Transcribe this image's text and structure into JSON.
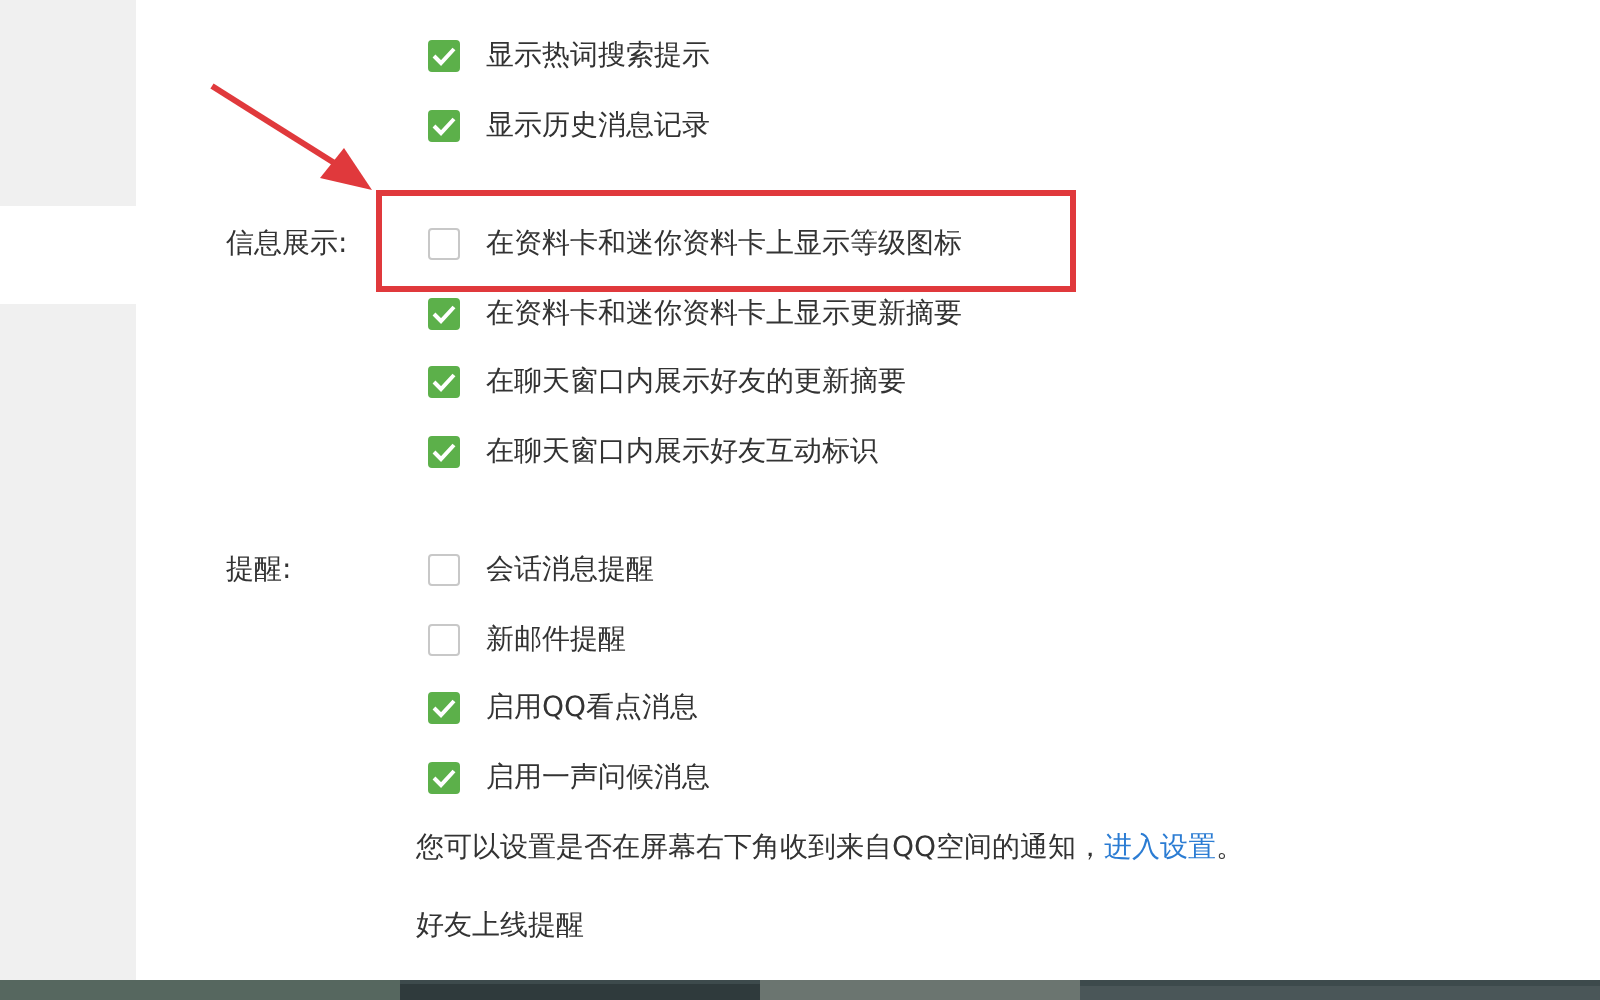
{
  "sections": [
    {
      "items": [
        {
          "label": "显示热词搜索提示",
          "checked": true,
          "highlighted": false
        },
        {
          "label": "显示历史消息记录",
          "checked": true,
          "highlighted": false
        }
      ]
    },
    {
      "label": "信息展示:",
      "items": [
        {
          "label": "在资料卡和迷你资料卡上显示等级图标",
          "checked": false,
          "highlighted": true
        },
        {
          "label": "在资料卡和迷你资料卡上显示更新摘要",
          "checked": true,
          "highlighted": false
        },
        {
          "label": "在聊天窗口内展示好友的更新摘要",
          "checked": true,
          "highlighted": false
        },
        {
          "label": "在聊天窗口内展示好友互动标识",
          "checked": true,
          "highlighted": false
        }
      ]
    },
    {
      "label": "提醒:",
      "items": [
        {
          "label": "会话消息提醒",
          "checked": false,
          "highlighted": false
        },
        {
          "label": "新邮件提醒",
          "checked": false,
          "highlighted": false
        },
        {
          "label": "启用QQ看点消息",
          "checked": true,
          "highlighted": false
        },
        {
          "label": "启用一声问候消息",
          "checked": true,
          "highlighted": false
        }
      ]
    }
  ],
  "note": {
    "text": "您可以设置是否在屏幕右下角收到来自QQ空间的通知，",
    "link": "进入设置",
    "end": "。"
  },
  "footer_item": "好友上线提醒"
}
